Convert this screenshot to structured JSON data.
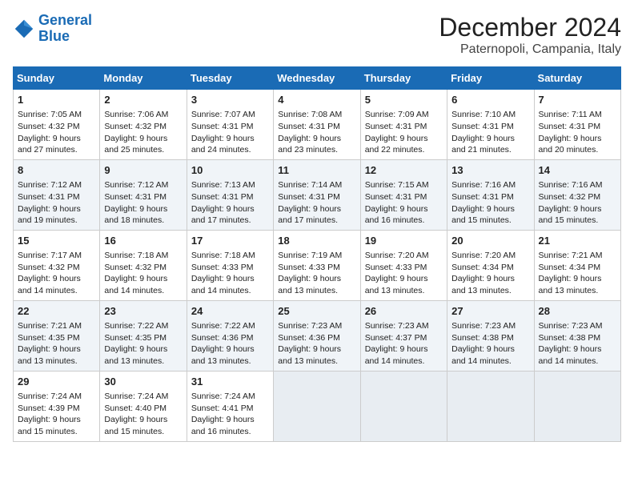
{
  "header": {
    "logo_line1": "General",
    "logo_line2": "Blue",
    "title": "December 2024",
    "subtitle": "Paternopoli, Campania, Italy"
  },
  "days_of_week": [
    "Sunday",
    "Monday",
    "Tuesday",
    "Wednesday",
    "Thursday",
    "Friday",
    "Saturday"
  ],
  "weeks": [
    [
      {
        "day": "1",
        "lines": [
          "Sunrise: 7:05 AM",
          "Sunset: 4:32 PM",
          "Daylight: 9 hours",
          "and 27 minutes."
        ]
      },
      {
        "day": "2",
        "lines": [
          "Sunrise: 7:06 AM",
          "Sunset: 4:32 PM",
          "Daylight: 9 hours",
          "and 25 minutes."
        ]
      },
      {
        "day": "3",
        "lines": [
          "Sunrise: 7:07 AM",
          "Sunset: 4:31 PM",
          "Daylight: 9 hours",
          "and 24 minutes."
        ]
      },
      {
        "day": "4",
        "lines": [
          "Sunrise: 7:08 AM",
          "Sunset: 4:31 PM",
          "Daylight: 9 hours",
          "and 23 minutes."
        ]
      },
      {
        "day": "5",
        "lines": [
          "Sunrise: 7:09 AM",
          "Sunset: 4:31 PM",
          "Daylight: 9 hours",
          "and 22 minutes."
        ]
      },
      {
        "day": "6",
        "lines": [
          "Sunrise: 7:10 AM",
          "Sunset: 4:31 PM",
          "Daylight: 9 hours",
          "and 21 minutes."
        ]
      },
      {
        "day": "7",
        "lines": [
          "Sunrise: 7:11 AM",
          "Sunset: 4:31 PM",
          "Daylight: 9 hours",
          "and 20 minutes."
        ]
      }
    ],
    [
      {
        "day": "8",
        "lines": [
          "Sunrise: 7:12 AM",
          "Sunset: 4:31 PM",
          "Daylight: 9 hours",
          "and 19 minutes."
        ]
      },
      {
        "day": "9",
        "lines": [
          "Sunrise: 7:12 AM",
          "Sunset: 4:31 PM",
          "Daylight: 9 hours",
          "and 18 minutes."
        ]
      },
      {
        "day": "10",
        "lines": [
          "Sunrise: 7:13 AM",
          "Sunset: 4:31 PM",
          "Daylight: 9 hours",
          "and 17 minutes."
        ]
      },
      {
        "day": "11",
        "lines": [
          "Sunrise: 7:14 AM",
          "Sunset: 4:31 PM",
          "Daylight: 9 hours",
          "and 17 minutes."
        ]
      },
      {
        "day": "12",
        "lines": [
          "Sunrise: 7:15 AM",
          "Sunset: 4:31 PM",
          "Daylight: 9 hours",
          "and 16 minutes."
        ]
      },
      {
        "day": "13",
        "lines": [
          "Sunrise: 7:16 AM",
          "Sunset: 4:31 PM",
          "Daylight: 9 hours",
          "and 15 minutes."
        ]
      },
      {
        "day": "14",
        "lines": [
          "Sunrise: 7:16 AM",
          "Sunset: 4:32 PM",
          "Daylight: 9 hours",
          "and 15 minutes."
        ]
      }
    ],
    [
      {
        "day": "15",
        "lines": [
          "Sunrise: 7:17 AM",
          "Sunset: 4:32 PM",
          "Daylight: 9 hours",
          "and 14 minutes."
        ]
      },
      {
        "day": "16",
        "lines": [
          "Sunrise: 7:18 AM",
          "Sunset: 4:32 PM",
          "Daylight: 9 hours",
          "and 14 minutes."
        ]
      },
      {
        "day": "17",
        "lines": [
          "Sunrise: 7:18 AM",
          "Sunset: 4:33 PM",
          "Daylight: 9 hours",
          "and 14 minutes."
        ]
      },
      {
        "day": "18",
        "lines": [
          "Sunrise: 7:19 AM",
          "Sunset: 4:33 PM",
          "Daylight: 9 hours",
          "and 13 minutes."
        ]
      },
      {
        "day": "19",
        "lines": [
          "Sunrise: 7:20 AM",
          "Sunset: 4:33 PM",
          "Daylight: 9 hours",
          "and 13 minutes."
        ]
      },
      {
        "day": "20",
        "lines": [
          "Sunrise: 7:20 AM",
          "Sunset: 4:34 PM",
          "Daylight: 9 hours",
          "and 13 minutes."
        ]
      },
      {
        "day": "21",
        "lines": [
          "Sunrise: 7:21 AM",
          "Sunset: 4:34 PM",
          "Daylight: 9 hours",
          "and 13 minutes."
        ]
      }
    ],
    [
      {
        "day": "22",
        "lines": [
          "Sunrise: 7:21 AM",
          "Sunset: 4:35 PM",
          "Daylight: 9 hours",
          "and 13 minutes."
        ]
      },
      {
        "day": "23",
        "lines": [
          "Sunrise: 7:22 AM",
          "Sunset: 4:35 PM",
          "Daylight: 9 hours",
          "and 13 minutes."
        ]
      },
      {
        "day": "24",
        "lines": [
          "Sunrise: 7:22 AM",
          "Sunset: 4:36 PM",
          "Daylight: 9 hours",
          "and 13 minutes."
        ]
      },
      {
        "day": "25",
        "lines": [
          "Sunrise: 7:23 AM",
          "Sunset: 4:36 PM",
          "Daylight: 9 hours",
          "and 13 minutes."
        ]
      },
      {
        "day": "26",
        "lines": [
          "Sunrise: 7:23 AM",
          "Sunset: 4:37 PM",
          "Daylight: 9 hours",
          "and 14 minutes."
        ]
      },
      {
        "day": "27",
        "lines": [
          "Sunrise: 7:23 AM",
          "Sunset: 4:38 PM",
          "Daylight: 9 hours",
          "and 14 minutes."
        ]
      },
      {
        "day": "28",
        "lines": [
          "Sunrise: 7:23 AM",
          "Sunset: 4:38 PM",
          "Daylight: 9 hours",
          "and 14 minutes."
        ]
      }
    ],
    [
      {
        "day": "29",
        "lines": [
          "Sunrise: 7:24 AM",
          "Sunset: 4:39 PM",
          "Daylight: 9 hours",
          "and 15 minutes."
        ]
      },
      {
        "day": "30",
        "lines": [
          "Sunrise: 7:24 AM",
          "Sunset: 4:40 PM",
          "Daylight: 9 hours",
          "and 15 minutes."
        ]
      },
      {
        "day": "31",
        "lines": [
          "Sunrise: 7:24 AM",
          "Sunset: 4:41 PM",
          "Daylight: 9 hours",
          "and 16 minutes."
        ]
      },
      null,
      null,
      null,
      null
    ]
  ]
}
